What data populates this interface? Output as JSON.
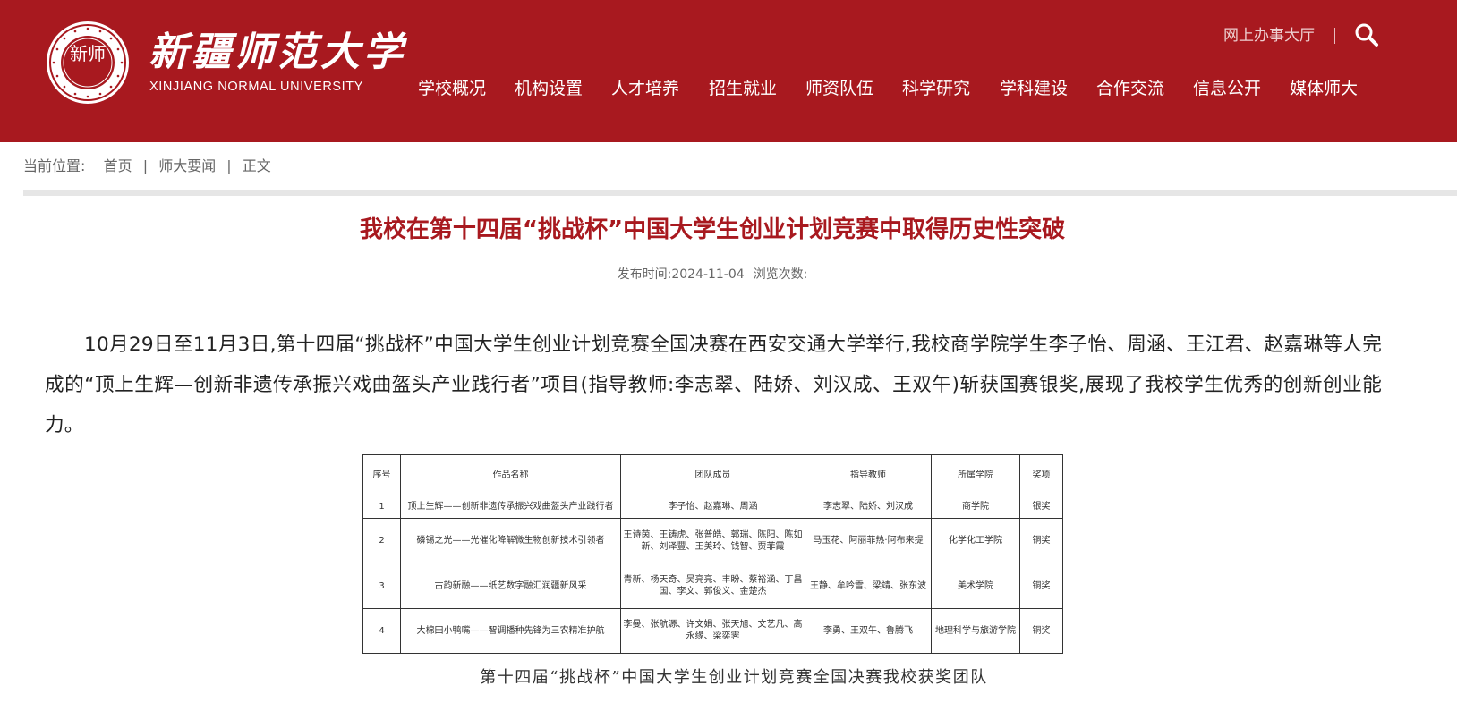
{
  "header": {
    "logo_seal_text": "新师",
    "logo_cn": "新疆师范大学",
    "logo_en": "XINJIANG NORMAL UNIVERSITY",
    "util_link": "网上办事大厅",
    "search_icon": "search-icon",
    "brand_color": "#a8191f"
  },
  "nav": {
    "items": [
      "学校概况",
      "机构设置",
      "人才培养",
      "招生就业",
      "师资队伍",
      "科学研究",
      "学科建设",
      "合作交流",
      "信息公开",
      "媒体师大"
    ]
  },
  "breadcrumb": {
    "label": "当前位置:",
    "items": [
      "首页",
      "师大要闻",
      "正文"
    ]
  },
  "article": {
    "title": "我校在第十四届“挑战杯”中国大学生创业计划竞赛中取得历史性突破",
    "publish_label": "发布时间:",
    "publish_date": "2024-11-04",
    "views_label": "浏览次数:",
    "body": "10月29日至11月3日,第十四届“挑战杯”中国大学生创业计划竞赛全国决赛在西安交通大学举行,我校商学院学生李子怡、周涵、王江君、赵嘉琳等人完成的“顶上生辉—创新非遗传承振兴戏曲盔头产业践行者”项目(指导教师:李志翠、陆娇、刘汉成、王双午)斩获国赛银奖,展现了我校学生优秀的创新创业能力。",
    "table": {
      "headers": [
        "序号",
        "作品名称",
        "团队成员",
        "指导教师",
        "所属学院",
        "奖项"
      ],
      "rows": [
        [
          "1",
          "顶上生辉——创新非遗传承振兴戏曲盔头产业践行者",
          "李子怡、赵嘉琳、周涵",
          "李志翠、陆娇、刘汉成",
          "商学院",
          "银奖"
        ],
        [
          "2",
          "磷锡之光——光催化降解微生物创新技术引领者",
          "王诗茵、王铸虎、张普皓、郭瑞、陈阳、陈如新、刘泽豐、王美玲、钱智、贾菲霞",
          "马玉花、阿丽菲热·阿布来提",
          "化学化工学院",
          "铜奖"
        ],
        [
          "3",
          "古韵新融——纸艺数字融汇润疆新风采",
          "青新、杨天奇、吴亮亮、丰盼、蔡裕涵、丁昌国、李文、郭俊义、金楚杰",
          "王静、牟吟雪、梁靖、张东波",
          "美术学院",
          "铜奖"
        ],
        [
          "4",
          "大棉田小鸭嘴——智调播种先锋为三农精准护航",
          "李曼、张航源、许文娟、张天旭、文艺凡、高永缘、梁奕霁",
          "李勇、王双午、鲁腾飞",
          "地理科学与旅游学院",
          "铜奖"
        ]
      ]
    },
    "caption": "第十四届“挑战杯”中国大学生创业计划竞赛全国决赛我校获奖团队"
  }
}
